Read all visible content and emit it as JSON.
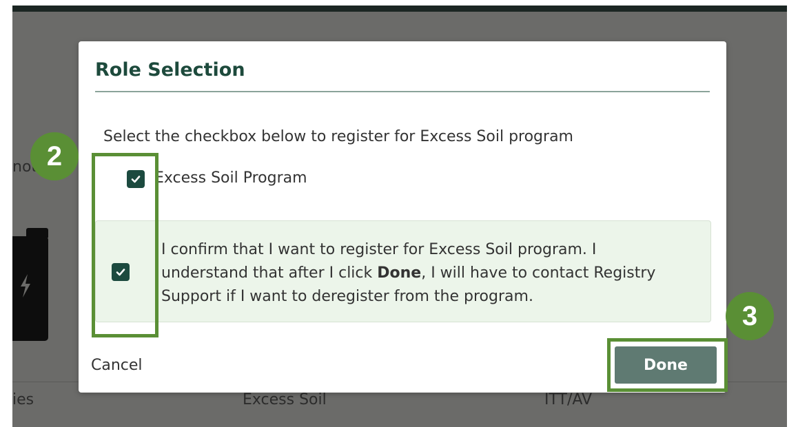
{
  "background": {
    "text_left_top": "not",
    "text_bottom_left": "ies",
    "text_bottom_mid": "Excess Soil",
    "text_bottom_right": "ITT/AV"
  },
  "modal": {
    "title": "Role Selection",
    "instruction": "Select the checkbox below to register for Excess Soil program",
    "program_checkbox": {
      "label": "Excess Soil Program",
      "checked": true
    },
    "confirm_checkbox": {
      "checked": true,
      "text_before": "I confirm that I want to register for Excess Soil program. I understand that after I click ",
      "text_bold": "Done",
      "text_after": ", I will have to contact Registry Support if I want to deregister from the program."
    },
    "cancel_label": "Cancel",
    "done_label": "Done"
  },
  "annotations": {
    "step_2": "2",
    "step_3": "3",
    "highlight_color": "#5a8f35"
  },
  "colors": {
    "primary_dark_green": "#1c4a3f",
    "title_green": "#1d4a3c",
    "done_button": "#5f7a72",
    "confirm_box_bg": "#ecf5ea"
  }
}
